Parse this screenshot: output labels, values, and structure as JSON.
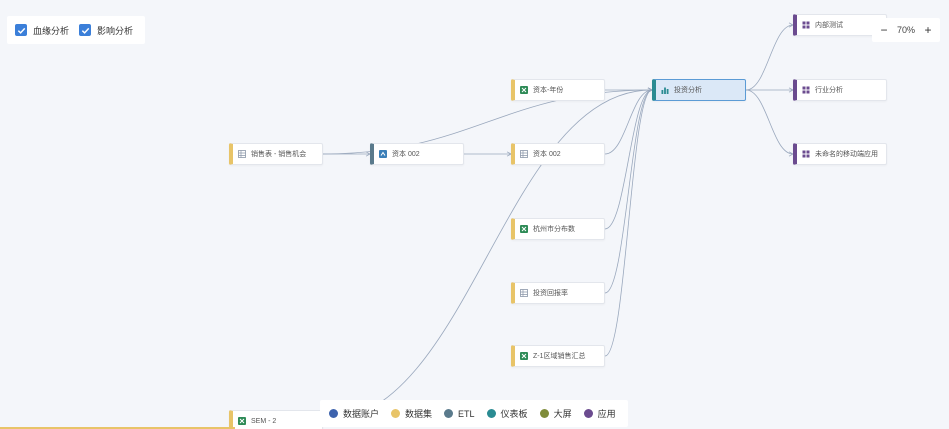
{
  "filters": {
    "lineage": {
      "label": "血缘分析",
      "checked": true
    },
    "impact": {
      "label": "影响分析",
      "checked": true
    }
  },
  "zoom": {
    "minus": "−",
    "level": "70%",
    "plus": "+"
  },
  "legend": [
    {
      "label": "数据账户",
      "color": "#3d63ad"
    },
    {
      "label": "数据集",
      "color": "#e8c468"
    },
    {
      "label": "ETL",
      "color": "#5a7a8c"
    },
    {
      "label": "仪表板",
      "color": "#2a8b92"
    },
    {
      "label": "大屏",
      "color": "#7f8c3a"
    },
    {
      "label": "应用",
      "color": "#6b4b8f"
    }
  ],
  "colors": {
    "dataset": "#e8c468",
    "etl": "#5a7a8c",
    "dashboard": "#2a8b92",
    "app": "#6b4b8f",
    "excel": "#2e8b57",
    "edge": "#9aa8bd"
  },
  "nodes": [
    {
      "id": "n_sales",
      "label": "销售表 - 销售机会",
      "type": "dataset",
      "icon": "dataset-table-icon"
    },
    {
      "id": "n_etl",
      "label": "资本 002",
      "type": "etl",
      "icon": "etl-icon"
    },
    {
      "id": "n_cap_year",
      "label": "资本-年份",
      "type": "dataset",
      "icon": "excel-icon"
    },
    {
      "id": "n_cap_002",
      "label": "资本 002",
      "type": "dataset",
      "icon": "dataset-table-icon"
    },
    {
      "id": "n_hz",
      "label": "杭州市分布数",
      "type": "dataset",
      "icon": "excel-icon"
    },
    {
      "id": "n_rate",
      "label": "投资回报率",
      "type": "dataset",
      "icon": "dataset-table-icon"
    },
    {
      "id": "n_region",
      "label": "Z-1区域销售汇总",
      "type": "dataset",
      "icon": "excel-icon"
    },
    {
      "id": "n_sem",
      "label": "SEM - 2",
      "type": "dataset",
      "icon": "excel-icon"
    },
    {
      "id": "n_invest",
      "label": "投资分析",
      "type": "dashboard",
      "icon": "bar-chart-icon",
      "selected": true
    },
    {
      "id": "n_internal",
      "label": "内部测试",
      "type": "app",
      "icon": "app-grid-icon"
    },
    {
      "id": "n_industry",
      "label": "行业分析",
      "type": "app",
      "icon": "app-grid-icon"
    },
    {
      "id": "n_mobile",
      "label": "未命名的移动端应用",
      "type": "app",
      "icon": "app-grid-icon"
    }
  ],
  "edges": [
    [
      "n_sales",
      "n_etl"
    ],
    [
      "n_sales",
      "n_invest"
    ],
    [
      "n_etl",
      "n_cap_002"
    ],
    [
      "n_cap_year",
      "n_invest"
    ],
    [
      "n_cap_002",
      "n_invest"
    ],
    [
      "n_hz",
      "n_invest"
    ],
    [
      "n_rate",
      "n_invest"
    ],
    [
      "n_region",
      "n_invest"
    ],
    [
      "n_sem",
      "n_invest"
    ],
    [
      "n_invest",
      "n_internal"
    ],
    [
      "n_invest",
      "n_industry"
    ],
    [
      "n_invest",
      "n_mobile"
    ]
  ]
}
